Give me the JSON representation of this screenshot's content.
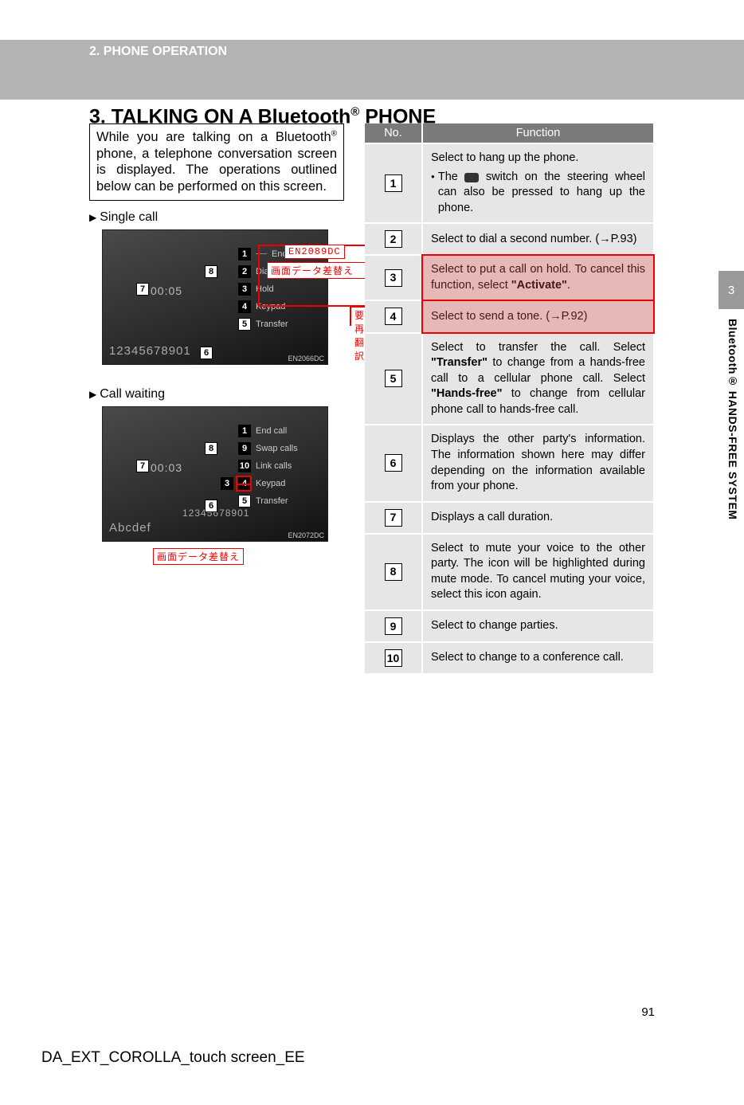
{
  "header": {
    "section_label": "2. PHONE OPERATION",
    "title_pre": "3. TALKING ON A Bluetooth",
    "title_sup": "®",
    "title_post": " PHONE"
  },
  "intro": {
    "text_pre": "While you are talking on a Bluetooth",
    "sup": "®",
    "text_post": " phone, a telephone conversation screen is displayed. The operations outlined below can be performed on this screen."
  },
  "left": {
    "single_call_label": "Single call",
    "call_waiting_label": "Call waiting",
    "shot1": {
      "timer": "00:05",
      "phone_number": "12345678901",
      "image_id": "EN2066DC",
      "items": [
        {
          "n": "1",
          "label": "End call"
        },
        {
          "n": "2",
          "label": "Dial"
        },
        {
          "n": "3",
          "label": "Hold"
        },
        {
          "n": "4",
          "label": "Keypad"
        },
        {
          "n": "5",
          "label": "Transfer"
        }
      ],
      "marker6": "6",
      "marker7": "7",
      "marker8": "8",
      "red_label_code": "EN2089DC",
      "red_text1": "画面データ差替え",
      "red_text2": "要再翻訳"
    },
    "shot2": {
      "timer": "00:03",
      "phone_number": "12345678901",
      "contact": "Abcdef",
      "image_id": "EN2072DC",
      "items": [
        {
          "n": "1",
          "label": "End call"
        },
        {
          "n": "9",
          "label": "Swap calls"
        },
        {
          "n": "10",
          "label": "Link calls"
        },
        {
          "n": "4",
          "label": "Keypad"
        },
        {
          "n": "5",
          "label": "Transfer"
        }
      ],
      "marker6": "6",
      "marker7": "7",
      "marker8": "8",
      "marker3": "3",
      "red_text": "画面データ差替え"
    }
  },
  "table": {
    "col_no": "No.",
    "col_func": "Function",
    "rows": [
      {
        "n": "1",
        "line1": "Select to hang up the phone.",
        "bullet_pre": "The ",
        "bullet_post": " switch on the steering wheel can also be pressed to hang up the phone."
      },
      {
        "n": "2",
        "text": "Select to dial a second number. (→P.93)"
      },
      {
        "n": "3",
        "pre": "Select to put a call on hold. To cancel this function, select ",
        "bold": "\"Activate\"",
        "post": "."
      },
      {
        "n": "4",
        "text": "Select to send a tone. (→P.92)"
      },
      {
        "n": "5",
        "pre": "Select to transfer the call. Select ",
        "b1": "\"Transfer\"",
        "mid": " to change from a hands-free call to a cellular phone call. Select ",
        "b2": "\"Hands-free\"",
        "post": " to change from cellular phone call to hands-free call."
      },
      {
        "n": "6",
        "text": "Displays the other party's information. The information shown here may differ depending on the information available from your phone."
      },
      {
        "n": "7",
        "text": "Displays a call duration."
      },
      {
        "n": "8",
        "text": "Select to mute your voice to the other party. The icon will be highlighted during mute mode. To cancel muting your voice, select this icon again."
      },
      {
        "n": "9",
        "text": "Select to change parties."
      },
      {
        "n": "10",
        "text": "Select to change to a conference call."
      }
    ]
  },
  "side": {
    "chapter": "3",
    "label": "Bluetooth® HANDS-FREE SYSTEM"
  },
  "footer": {
    "page": "91",
    "doc_id": "DA_EXT_COROLLA_touch screen_EE"
  }
}
